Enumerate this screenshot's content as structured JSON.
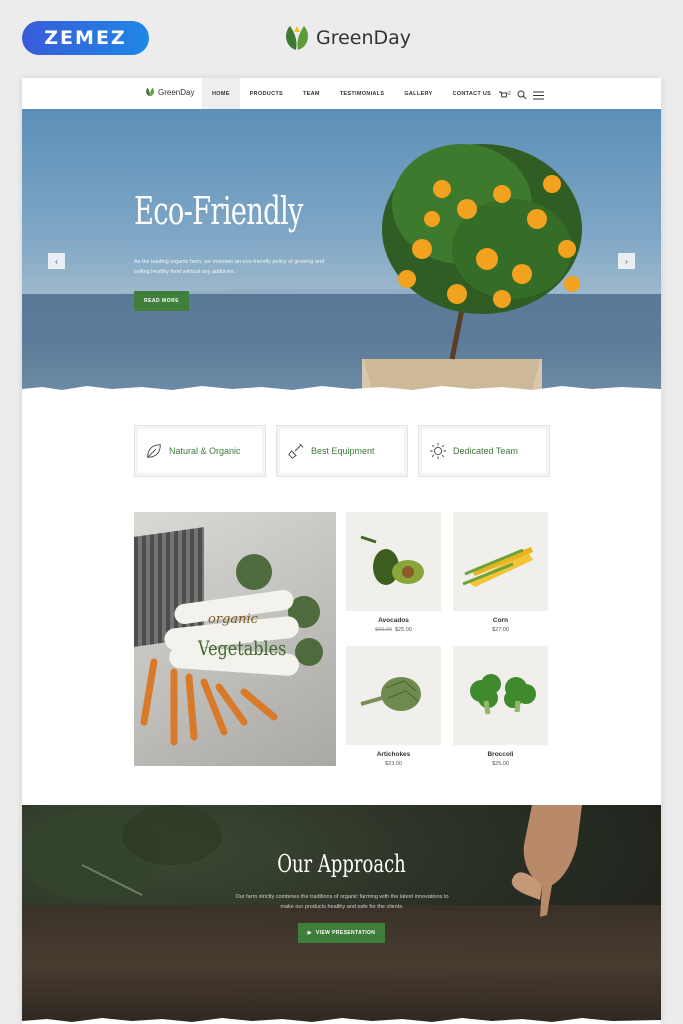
{
  "outer": {
    "badge": "ZEMEZ",
    "brand": "GreenDay"
  },
  "nav": {
    "logo": "GreenDay",
    "items": [
      "HOME",
      "PRODUCTS",
      "TEAM",
      "TESTIMONIALS",
      "GALLERY",
      "CONTACT US"
    ],
    "cart_count": "2"
  },
  "hero": {
    "title": "Eco-Friendly",
    "description": "As the leading organic farm, we maintain an eco-friendly policy of growing and selling healthy food without any additives.",
    "button": "READ MORE"
  },
  "features": [
    {
      "label": "Natural & Organic",
      "icon": "leaf-icon"
    },
    {
      "label": "Best Equipment",
      "icon": "shovel-icon"
    },
    {
      "label": "Dedicated Team",
      "icon": "sun-icon"
    }
  ],
  "promo": {
    "line1": "organic",
    "line2": "Vegetables"
  },
  "products": [
    {
      "name": "Avocados",
      "old_price": "$50.00",
      "price": "$25.00"
    },
    {
      "name": "Corn",
      "price": "$27.00"
    },
    {
      "name": "Artichokes",
      "price": "$23.00"
    },
    {
      "name": "Broccoli",
      "price": "$25.00"
    }
  ],
  "approach": {
    "title": "Our Approach",
    "description": "Our farm strictly combines the traditions of organic farming with the latest innovations to make our products healthy and safe for the clients.",
    "button": "VIEW PRESENTATION",
    "button_icon": "play-icon"
  },
  "colors": {
    "accent_green": "#3f7f3b",
    "badge_blue": "#2d6fe0"
  }
}
